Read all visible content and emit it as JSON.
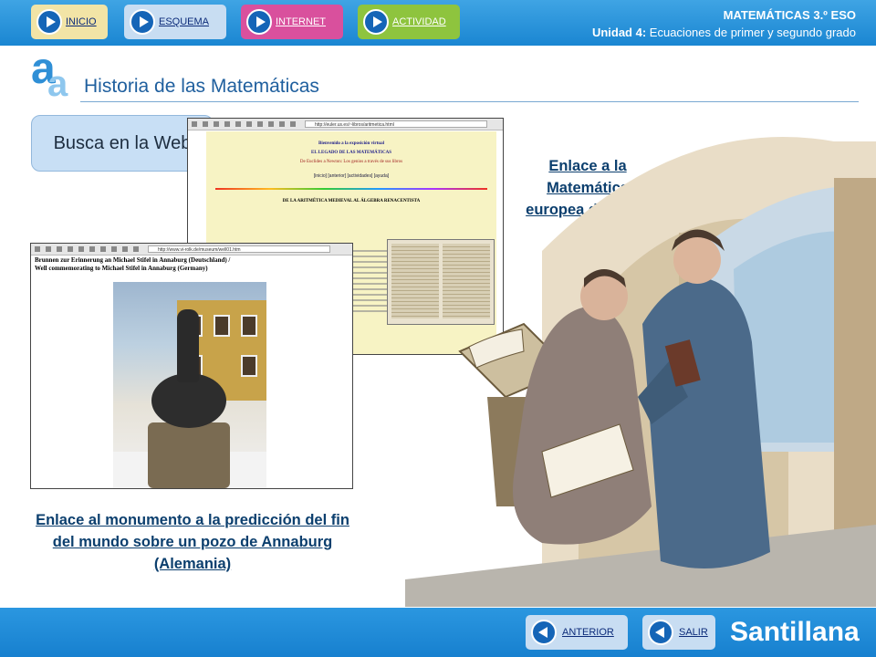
{
  "header": {
    "nav": {
      "inicio": "INICIO",
      "esquema": "ESQUEMA",
      "internet": "INTERNET",
      "actividad": "ACTIVIDAD"
    },
    "subject": "MATEMÁTICAS 3.º ESO",
    "unit_label": "Unidad 4:",
    "unit_title": "Ecuaciones de primer y segundo grado"
  },
  "logo": {
    "big": "a",
    "small": "a"
  },
  "page_title": "Historia de las Matemáticas",
  "section_badge": "Busca en la Web",
  "screenshot1": {
    "url": "http://euler.us.es/~libros/aritmetica.html",
    "welcome": "Bienvenido a la exposición virtual",
    "title": "EL LEGADO DE LAS MATEMÁTICAS",
    "subtitle": "De Euclides a Newton: Los genios a través de sus libros",
    "nav_links": "[inicio] [anterior] [actividades] [ayuda]",
    "section": "DE LA ARITMÉTICA MEDIEVAL AL ÁLGEBRA RENACENTISTA"
  },
  "screenshot2": {
    "url": "http://www.vi-rolk.de/museum/well01.htm",
    "caption_line1": "Brunnen zur Erinnerung an Michael Stifel in Annaburg (Deutschland) /",
    "caption_line2": "Well commemorating to Michael Stifel in Annaburg (Germany)"
  },
  "links": {
    "european_math": "Enlace a la Matemática europea del siglo XVI",
    "monument": "Enlace al monumento a la predicción del fin del mundo sobre un pozo de Annaburg (Alemania)"
  },
  "footer": {
    "anterior": "ANTERIOR",
    "salir": "SALIR",
    "brand": "Santillana"
  },
  "colors": {
    "header_blue": "#2b97e0",
    "internet_pink": "#d9509d",
    "actividad_green": "#8ec43e",
    "link_color": "#0c3f6e"
  },
  "icons": [
    "play-icon",
    "back-icon",
    "search-icon"
  ]
}
